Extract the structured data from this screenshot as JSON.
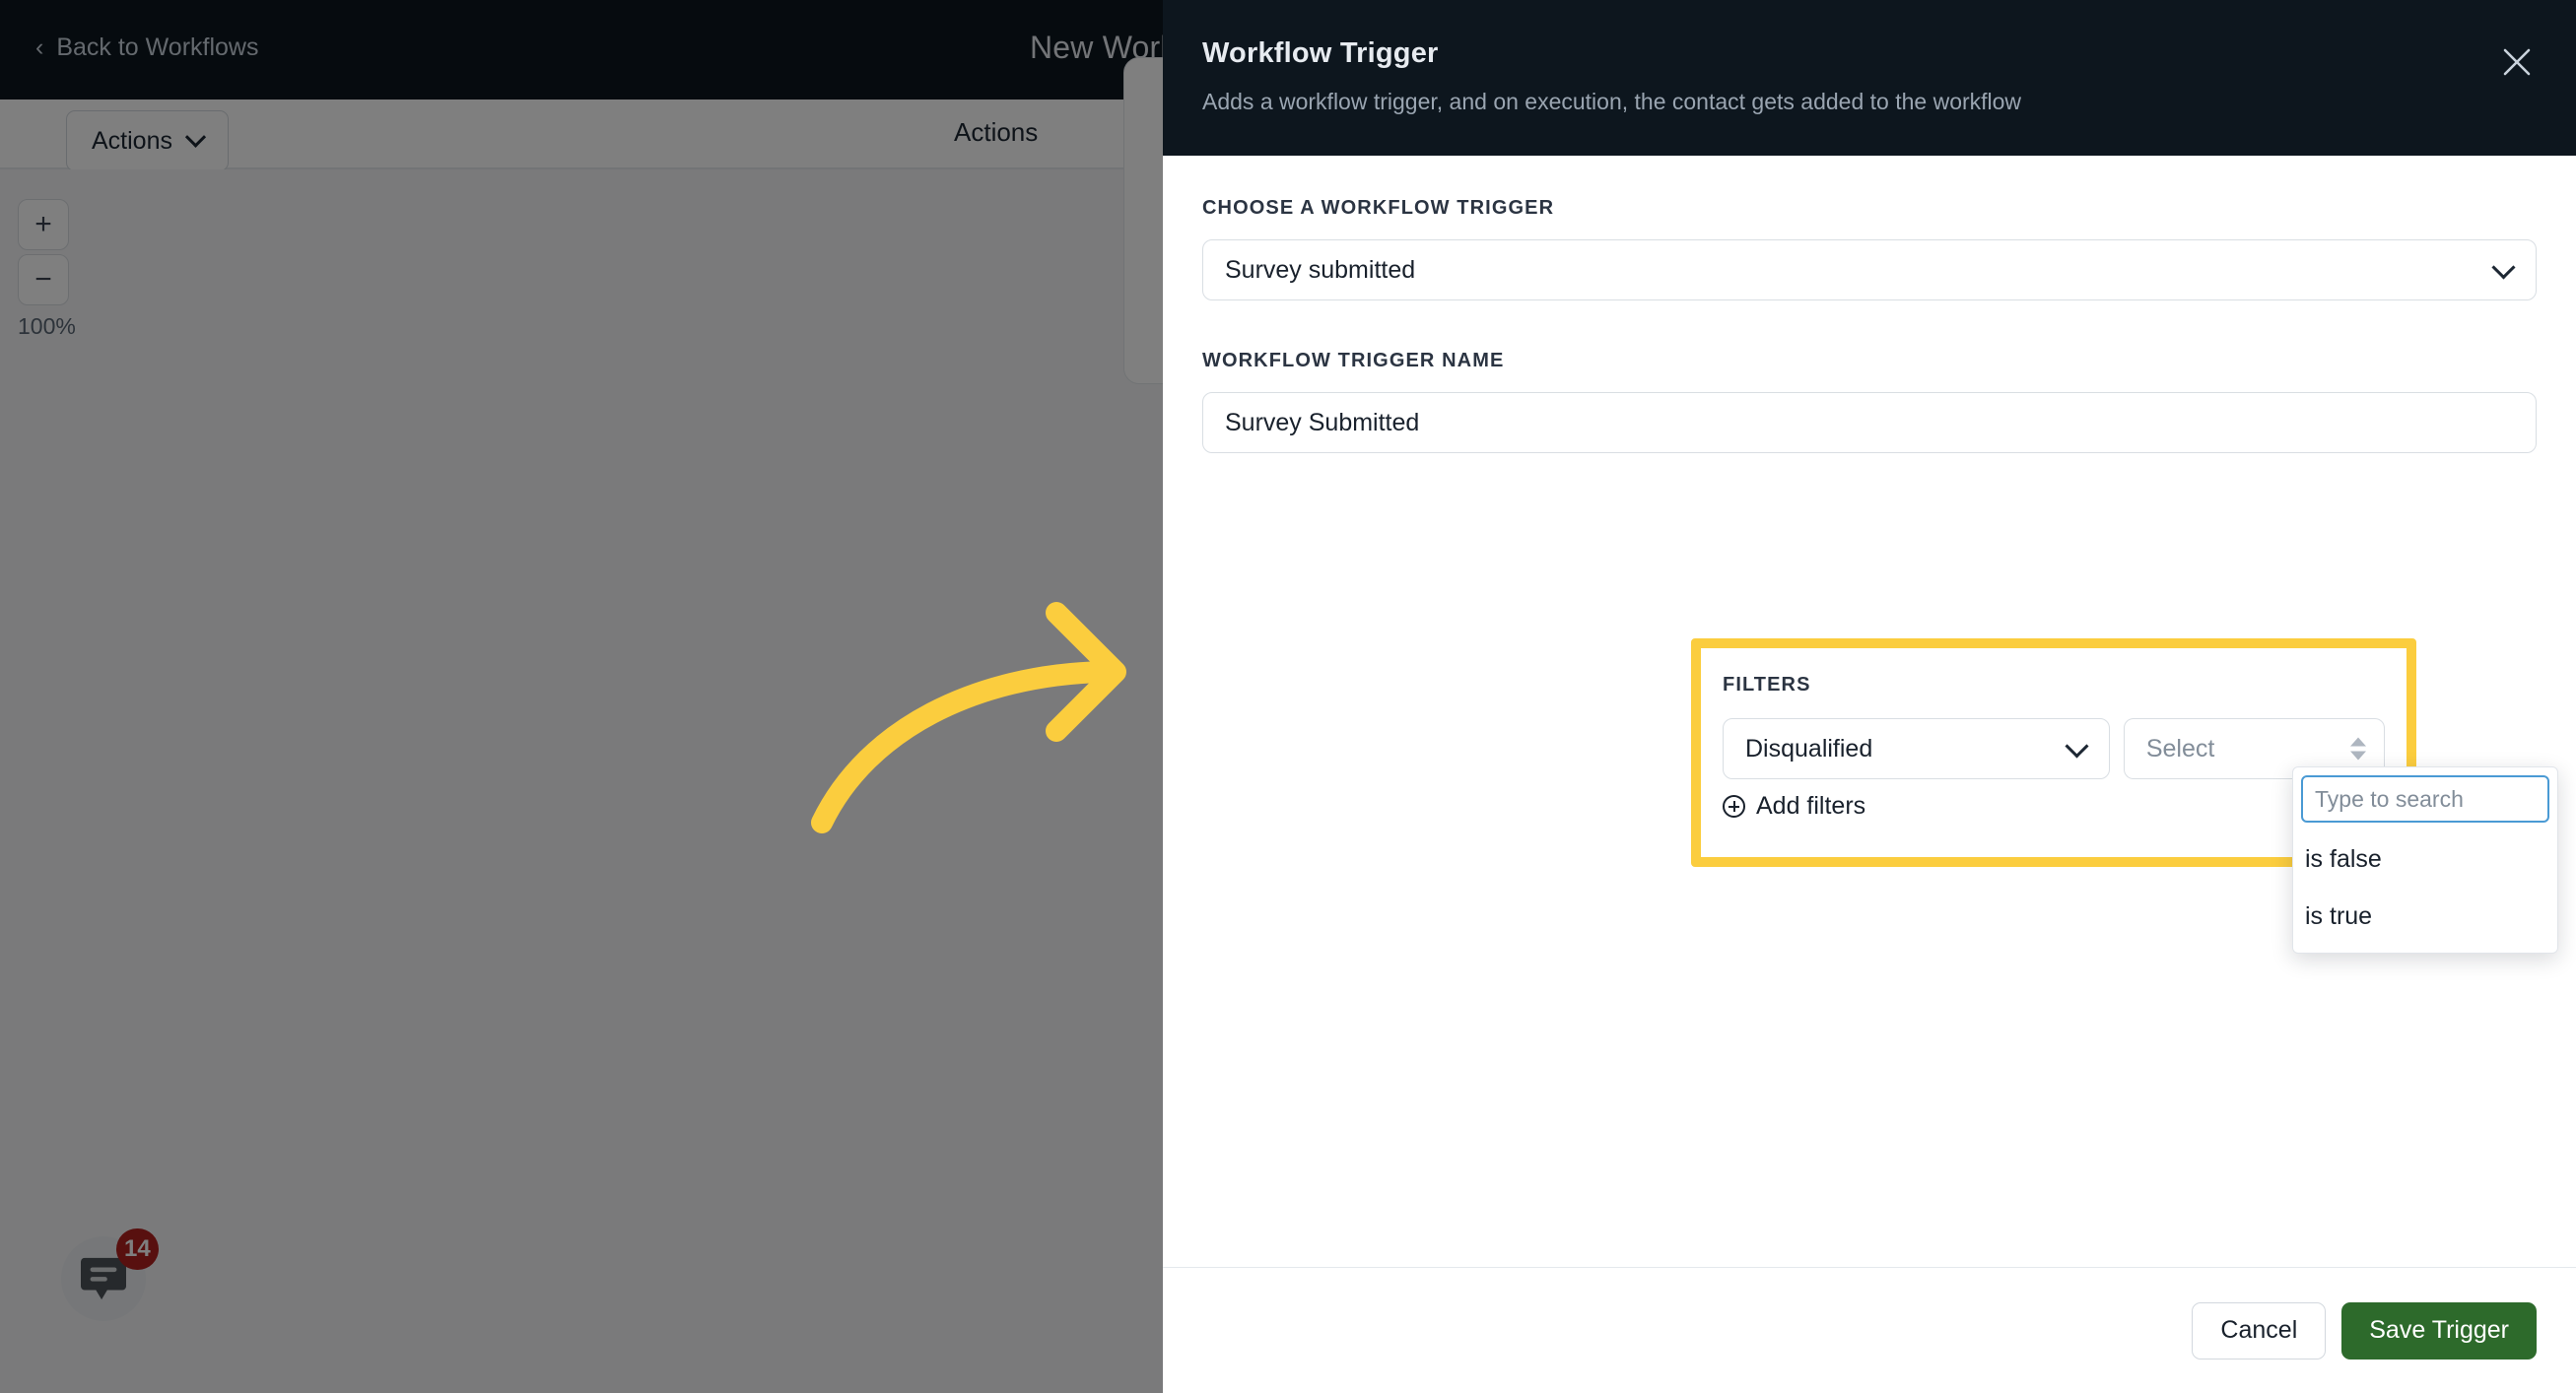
{
  "app": {
    "topbar": {
      "back_label": "Back to Workflows",
      "back_icon": "chevron-left-icon",
      "title": "New Worl"
    },
    "subbar": {
      "actions_dropdown_label": "Actions",
      "tab_label": "Actions"
    },
    "canvas": {
      "zoom_in_label": "+",
      "zoom_out_label": "−",
      "zoom_level": "100%",
      "delete_icon": "trash-icon"
    },
    "chat_widget": {
      "icon": "chat-bubble-icon",
      "unread_count": "14"
    }
  },
  "drawer": {
    "title": "Workflow Trigger",
    "subtitle": "Adds a workflow trigger, and on execution, the contact gets added to the workflow",
    "close_icon": "close-icon",
    "trigger_type": {
      "label": "CHOOSE A WORKFLOW TRIGGER",
      "value": "Survey submitted",
      "chevron_icon": "chevron-down-icon"
    },
    "trigger_name": {
      "label": "WORKFLOW TRIGGER NAME",
      "value": "Survey Submitted"
    },
    "filters": {
      "label": "FILTERS",
      "field": {
        "value": "Disqualified",
        "chevron_icon": "chevron-down-icon"
      },
      "operator": {
        "placeholder": "Select",
        "stepper_icon": "chevron-up-down-icon"
      },
      "add_filters_label": "Add filters",
      "add_filters_icon": "plus-circle-icon",
      "highlight_color": "#fbcd3e"
    },
    "dropdown": {
      "search_placeholder": "Type to search",
      "options": [
        {
          "label": "is false"
        },
        {
          "label": "is true"
        }
      ]
    },
    "footer": {
      "cancel_label": "Cancel",
      "save_label": "Save Trigger",
      "save_color": "#2d6a2b"
    }
  },
  "annotation": {
    "arrow_icon": "curved-arrow-right-icon",
    "arrow_color": "#fbcd3e"
  }
}
